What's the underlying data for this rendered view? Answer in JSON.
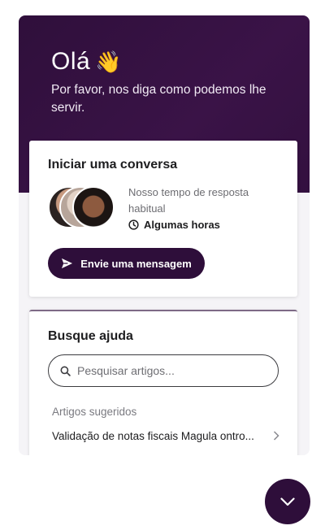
{
  "hero": {
    "greeting": "Olá",
    "wave_emoji": "👋",
    "subtitle": "Por favor, nos diga como podemos lhe servir."
  },
  "conversation": {
    "title": "Iniciar uma conversa",
    "response_label": "Nosso tempo de resposta habitual",
    "response_time": "Algumas horas",
    "send_button": "Envie uma mensagem",
    "icons": [
      "clock-icon",
      "send-icon"
    ]
  },
  "help": {
    "title": "Busque ajuda",
    "search_placeholder": "Pesquisar artigos...",
    "search_value": "",
    "suggested_label": "Artigos sugeridos",
    "articles": [
      {
        "title": "Validação de notas fiscais Magula ontro..."
      }
    ]
  },
  "launcher": {
    "icon": "chevron-down-icon"
  },
  "colors": {
    "brand": "#2e0e3a",
    "hero_bg": "#33103f"
  }
}
